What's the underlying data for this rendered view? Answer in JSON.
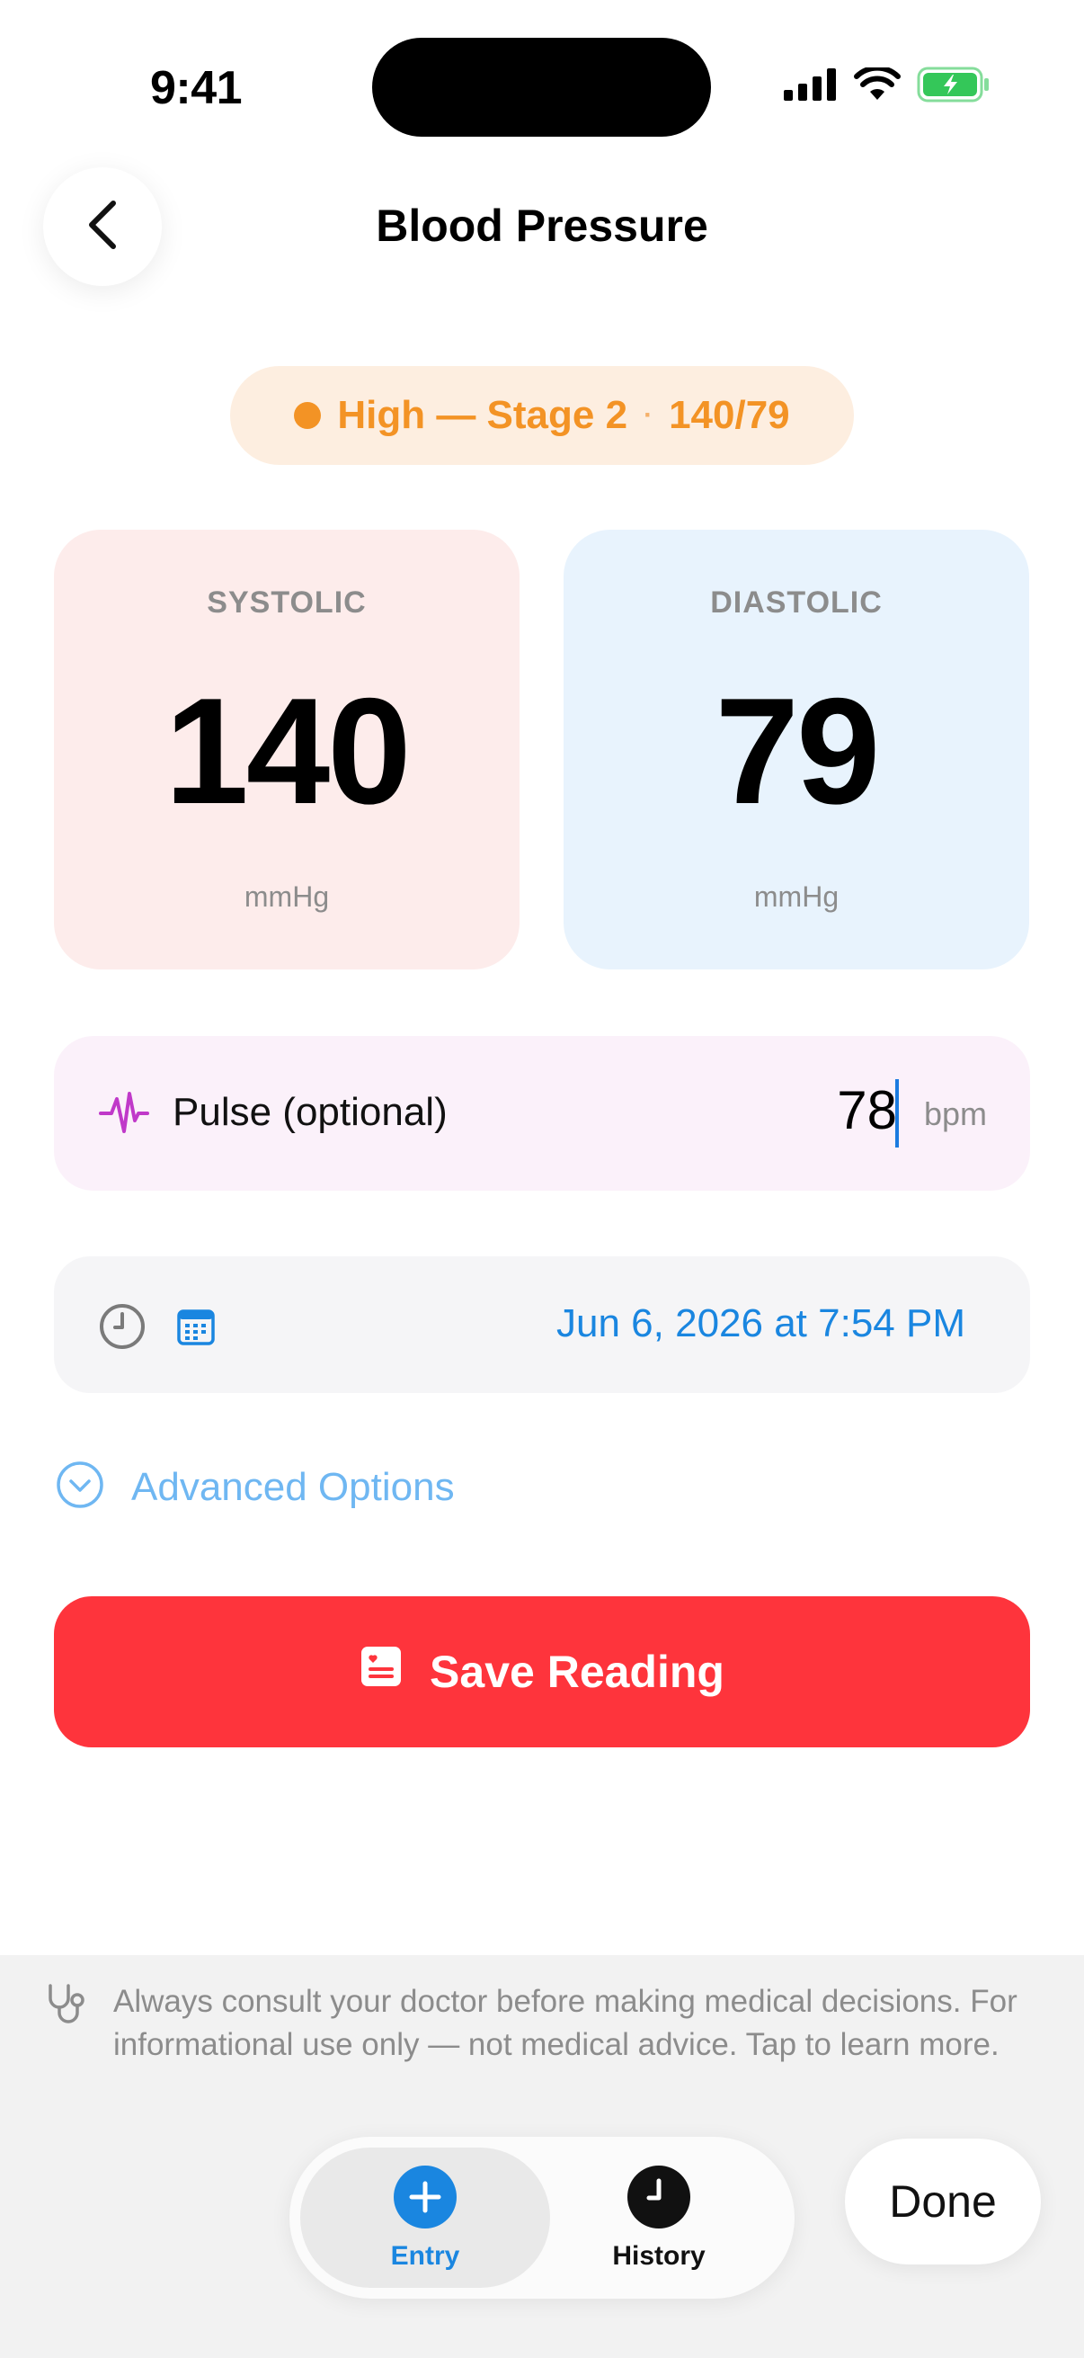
{
  "status_bar": {
    "time": "9:41"
  },
  "nav": {
    "title": "Blood Pressure",
    "back_icon": "chevron-left-icon"
  },
  "status_pill": {
    "category": "High — Stage 2",
    "separator": "·",
    "reading": "140/79",
    "color": "#f39325"
  },
  "systolic": {
    "label": "SYSTOLIC",
    "value": "140",
    "unit": "mmHg",
    "bg": "#fdeceb"
  },
  "diastolic": {
    "label": "DIASTOLIC",
    "value": "79",
    "unit": "mmHg",
    "bg": "#e8f3fd"
  },
  "pulse": {
    "icon": "waveform-icon",
    "label": "Pulse (optional)",
    "value": "78",
    "unit": "bpm"
  },
  "datetime": {
    "clock_icon": "clock-icon",
    "calendar_icon": "calendar-icon",
    "value": "Jun 6, 2026 at 7:54 PM"
  },
  "advanced": {
    "icon": "chevron-down-circle-icon",
    "label": "Advanced Options"
  },
  "save": {
    "icon": "heart-document-icon",
    "label": "Save Reading",
    "color": "#fe343c"
  },
  "disclaimer": {
    "icon": "stethoscope-icon",
    "text": "Always consult your doctor before making medical decisions. For informational use only — not medical advice. Tap to learn more."
  },
  "tabs": [
    {
      "label": "Entry",
      "icon": "plus-circle-icon",
      "active": true
    },
    {
      "label": "History",
      "icon": "clock-filled-icon",
      "active": false
    }
  ],
  "done": {
    "label": "Done"
  },
  "colors": {
    "accent_blue": "#1a86e0",
    "warning_orange": "#f39325",
    "danger_red": "#fe343c"
  }
}
